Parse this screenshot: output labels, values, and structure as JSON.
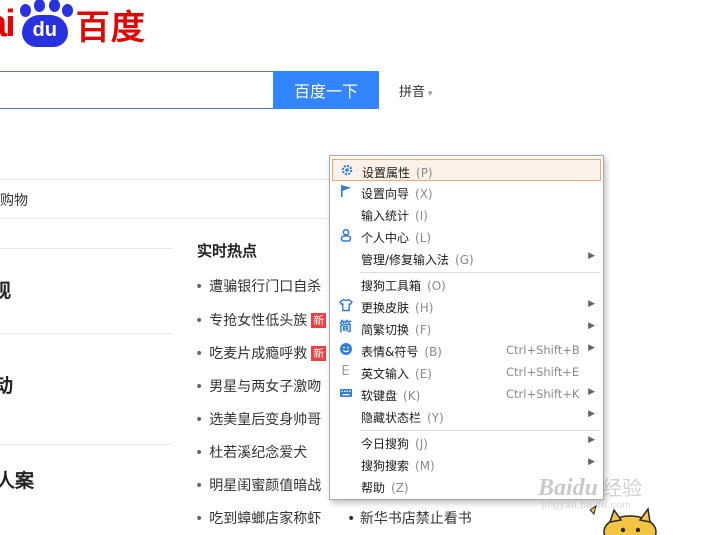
{
  "logo": {
    "bai": "ai",
    "du": "du",
    "cn": "百度"
  },
  "search": {
    "query": "",
    "button_label": "百度一下",
    "pinyin_label": "拼音"
  },
  "nav": {
    "partial_item": "购物"
  },
  "left_news": {
    "headings": [
      "观",
      "动",
      "人案"
    ]
  },
  "hot": {
    "title": "实时热点",
    "items": [
      {
        "text": "遭骗银行门口自杀",
        "badge": ""
      },
      {
        "text": "专抢女性低头族",
        "badge": "新"
      },
      {
        "text": "吃麦片成瘾呼救",
        "badge": "新"
      },
      {
        "text": "男星与两女子激吻",
        "badge": ""
      },
      {
        "text": "选美皇后变身帅哥",
        "badge": ""
      },
      {
        "text": "杜若溪纪念爱犬",
        "badge": ""
      },
      {
        "text": "明星闺蜜颜值暗战",
        "badge": ""
      },
      {
        "text": "吃到蟑螂店家称虾",
        "badge": ""
      }
    ],
    "extra_item": "新华书店禁止看书"
  },
  "menu": {
    "items": [
      {
        "icon": "gear-icon",
        "label": "设置属性",
        "key": "(P)",
        "shortcut": "",
        "submenu": false
      },
      {
        "icon": "flag-icon",
        "label": "设置向导",
        "key": "(X)",
        "shortcut": "",
        "submenu": false
      },
      {
        "icon": "",
        "label": "输入统计",
        "key": "(I)",
        "shortcut": "",
        "submenu": false
      },
      {
        "icon": "user-icon",
        "label": "个人中心",
        "key": "(L)",
        "shortcut": "",
        "submenu": false
      },
      {
        "icon": "",
        "label": "管理/修复输入法",
        "key": "(G)",
        "shortcut": "",
        "submenu": true
      },
      {
        "icon": "",
        "label": "搜狗工具箱",
        "key": "(O)",
        "shortcut": "",
        "submenu": false
      },
      {
        "icon": "shirt-icon",
        "label": "更换皮肤",
        "key": "(H)",
        "shortcut": "",
        "submenu": true
      },
      {
        "icon": "simplified-icon",
        "label": "简繁切换",
        "key": "(F)",
        "shortcut": "",
        "submenu": true
      },
      {
        "icon": "smiley-icon",
        "label": "表情&符号",
        "key": "(B)",
        "shortcut": "Ctrl+Shift+B",
        "submenu": true
      },
      {
        "icon": "english-icon",
        "label": "英文输入",
        "key": "(E)",
        "shortcut": "Ctrl+Shift+E",
        "submenu": false
      },
      {
        "icon": "keyboard-icon",
        "label": "软键盘",
        "key": "(K)",
        "shortcut": "Ctrl+Shift+K",
        "submenu": true
      },
      {
        "icon": "",
        "label": "隐藏状态栏",
        "key": "(Y)",
        "shortcut": "",
        "submenu": true
      },
      {
        "icon": "",
        "label": "今日搜狗",
        "key": "(J)",
        "shortcut": "",
        "submenu": true
      },
      {
        "icon": "",
        "label": "搜狗搜索",
        "key": "(M)",
        "shortcut": "",
        "submenu": true
      },
      {
        "icon": "",
        "label": "帮助",
        "key": "(Z)",
        "shortcut": "",
        "submenu": false
      }
    ]
  },
  "watermark": {
    "brand": "Baidu",
    "cn": "经验",
    "url": "jingyan.baidu.com"
  },
  "colors": {
    "brand_red": "#e10602",
    "brand_blue": "#2932e1",
    "search_blue": "#3385ff",
    "menu_highlight_border": "#f3a774"
  }
}
